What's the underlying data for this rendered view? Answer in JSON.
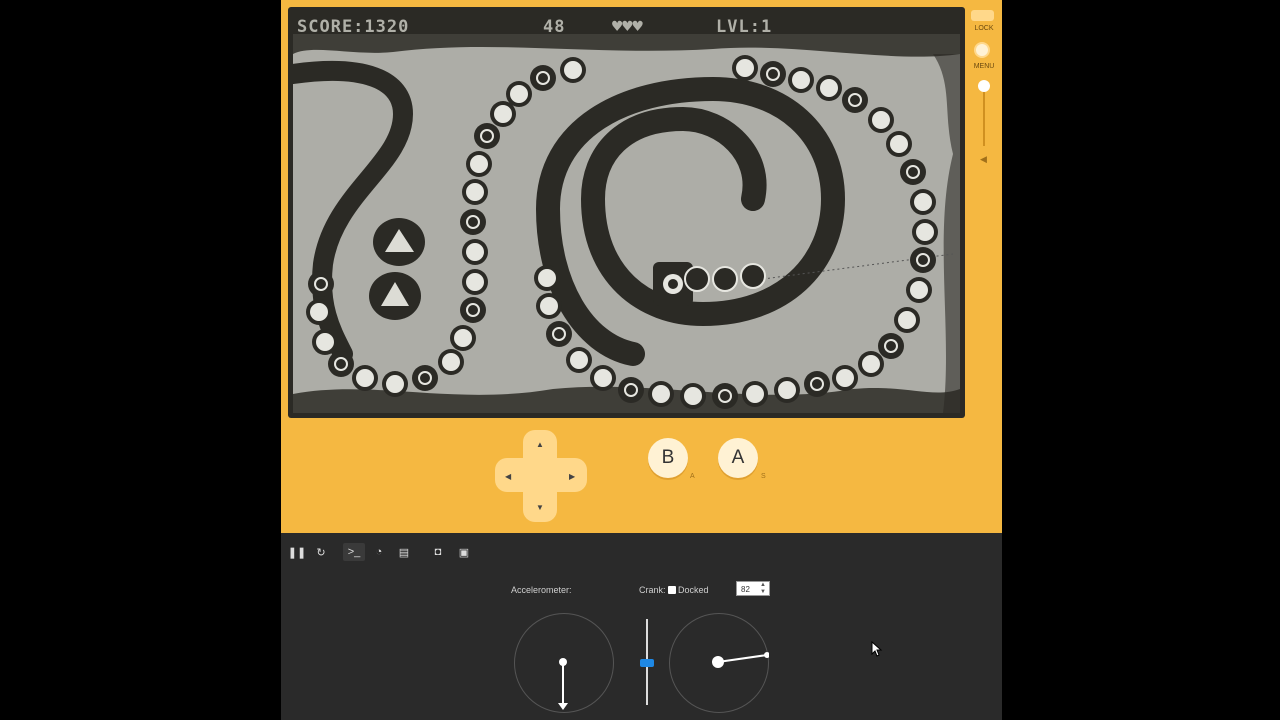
{
  "hud": {
    "score": "SCORE:1320",
    "timer": "48",
    "hearts": "♥♥♥",
    "level": "LVL:1"
  },
  "side": {
    "lock_label": "LOCK",
    "menu_label": "MENU",
    "volume_icon": "speaker-icon"
  },
  "buttons": {
    "b_label": "B",
    "b_key": "A",
    "a_label": "A",
    "a_key": "S",
    "dpad": {
      "up": "▲",
      "down": "▼",
      "left": "◀",
      "right": "▶"
    }
  },
  "toolbar": {
    "items": [
      "pause-icon",
      "restart-icon",
      "console-icon",
      "stopwatch-icon",
      "print-icon",
      "screenshot-icon",
      "record-icon"
    ],
    "glyphs": [
      "❚❚",
      "↻",
      ">_",
      "◔",
      "▤",
      "◘",
      "▣"
    ]
  },
  "controls": {
    "accelerometer_label": "Accelerometer:",
    "crank_label": "Crank:",
    "docked_label": "Docked",
    "crank_value": "82",
    "docked": false
  },
  "colors": {
    "device": "#f5b841",
    "screen_bg": "#adada7",
    "ink": "#2b2a25",
    "panel": "#2a2a2a",
    "accent": "#1e88e5"
  }
}
